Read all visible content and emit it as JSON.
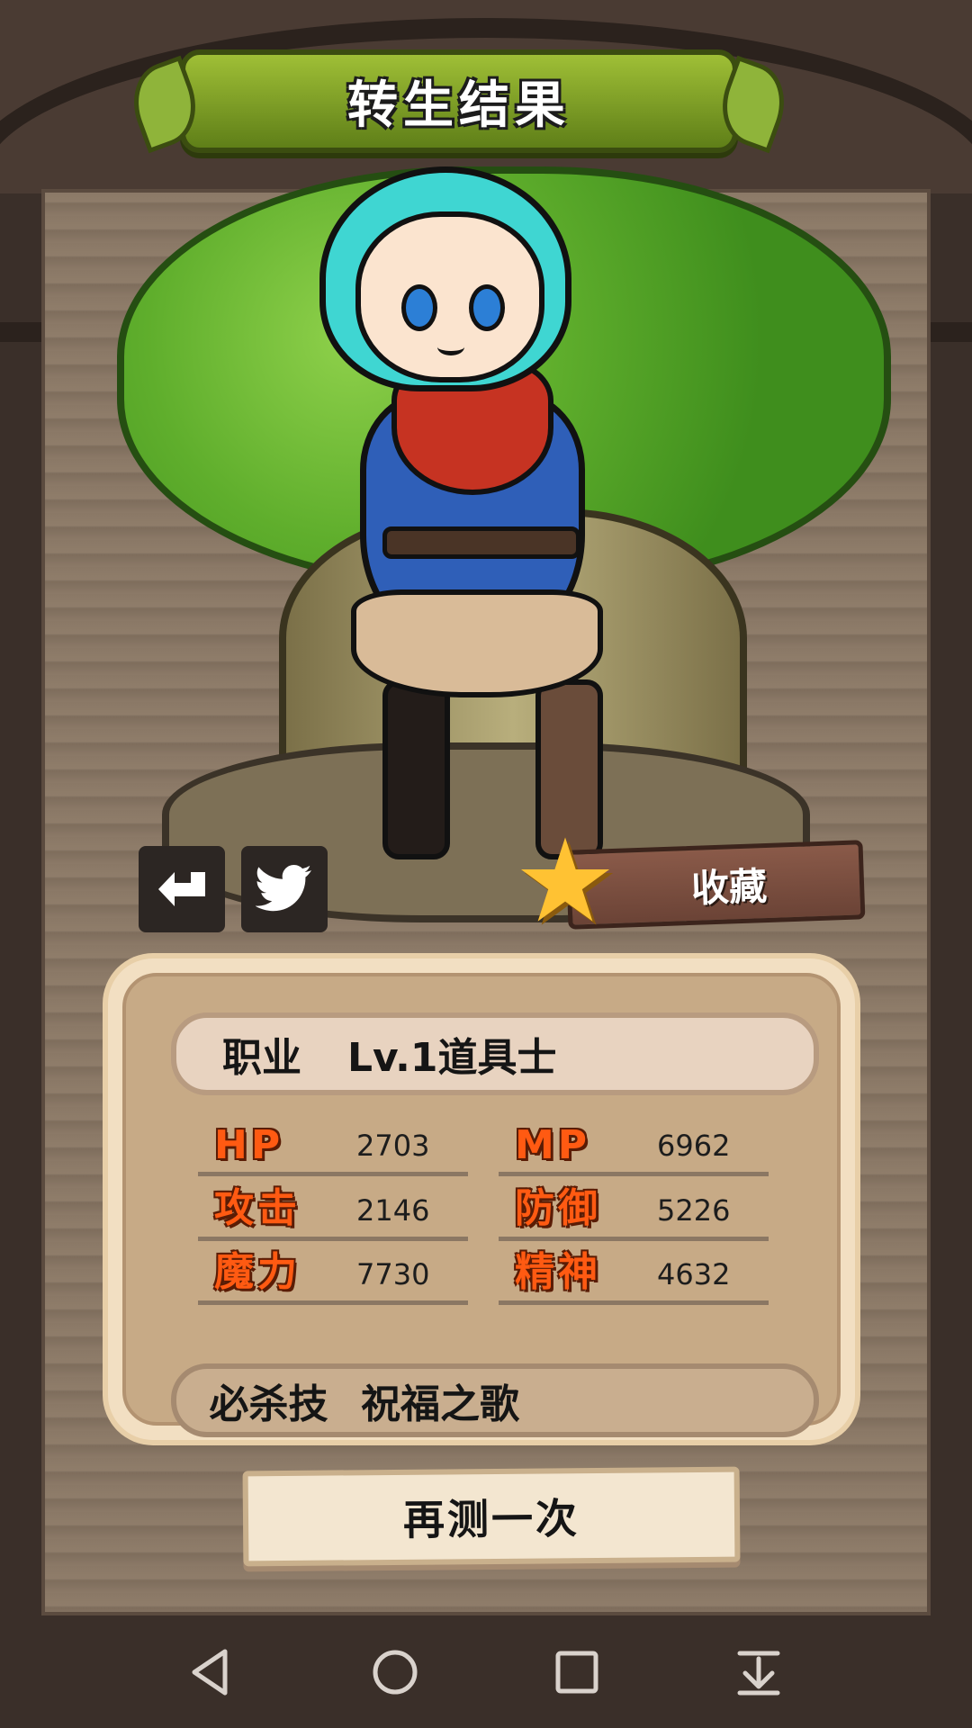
{
  "title": "转生结果",
  "actions": {
    "share_icon": "share-return-icon",
    "twitter_icon": "twitter-bird-icon",
    "favorite_label": "收藏"
  },
  "job": {
    "label": "职业",
    "value": "Lv.1道具士"
  },
  "stats": [
    {
      "label": "HP",
      "value": "2703"
    },
    {
      "label": "MP",
      "value": "6962"
    },
    {
      "label": "攻击",
      "value": "2146"
    },
    {
      "label": "防御",
      "value": "5226"
    },
    {
      "label": "魔力",
      "value": "7730"
    },
    {
      "label": "精神",
      "value": "4632"
    }
  ],
  "skill": {
    "label": "必杀技",
    "value": "祝福之歌"
  },
  "retry_label": "再测一次",
  "colors": {
    "title_green": "#6f8f1e",
    "stat_label_orange": "#ff5a12",
    "star_yellow": "#ffc233"
  },
  "navbar": {
    "icons": [
      "back-triangle-icon",
      "home-circle-icon",
      "recent-square-icon",
      "notification-down-icon"
    ]
  }
}
